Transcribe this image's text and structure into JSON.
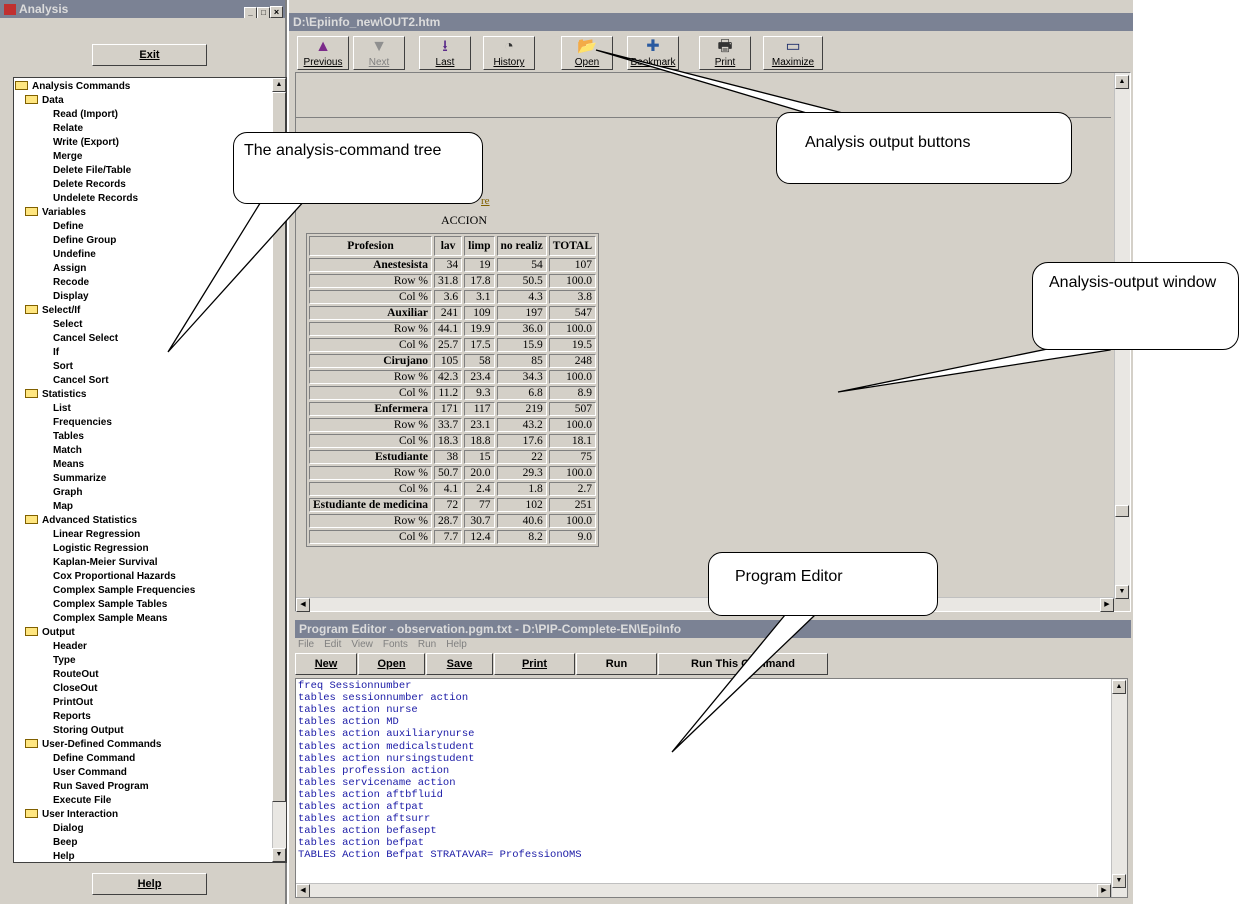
{
  "left": {
    "title": "Analysis",
    "exit": "Exit",
    "help": "Help",
    "tree": [
      {
        "t": "Analysis Commands",
        "f": 1,
        "l": 0
      },
      {
        "t": "Data",
        "f": 1,
        "l": 1
      },
      {
        "t": "Read (Import)",
        "l": 2
      },
      {
        "t": "Relate",
        "l": 2
      },
      {
        "t": "Write (Export)",
        "l": 2
      },
      {
        "t": "Merge",
        "l": 2
      },
      {
        "t": "Delete File/Table",
        "l": 2
      },
      {
        "t": "Delete Records",
        "l": 2
      },
      {
        "t": "Undelete Records",
        "l": 2
      },
      {
        "t": "Variables",
        "f": 1,
        "l": 1
      },
      {
        "t": "Define",
        "l": 2
      },
      {
        "t": "Define Group",
        "l": 2
      },
      {
        "t": "Undefine",
        "l": 2
      },
      {
        "t": "Assign",
        "l": 2
      },
      {
        "t": "Recode",
        "l": 2
      },
      {
        "t": "Display",
        "l": 2
      },
      {
        "t": "Select/If",
        "f": 1,
        "l": 1
      },
      {
        "t": "Select",
        "l": 2
      },
      {
        "t": "Cancel Select",
        "l": 2
      },
      {
        "t": "If",
        "l": 2
      },
      {
        "t": "Sort",
        "l": 2
      },
      {
        "t": "Cancel Sort",
        "l": 2
      },
      {
        "t": "Statistics",
        "f": 1,
        "l": 1
      },
      {
        "t": "List",
        "l": 2
      },
      {
        "t": "Frequencies",
        "l": 2
      },
      {
        "t": "Tables",
        "l": 2
      },
      {
        "t": "Match",
        "l": 2
      },
      {
        "t": "Means",
        "l": 2
      },
      {
        "t": "Summarize",
        "l": 2
      },
      {
        "t": "Graph",
        "l": 2
      },
      {
        "t": "Map",
        "l": 2
      },
      {
        "t": "Advanced Statistics",
        "f": 1,
        "l": 1
      },
      {
        "t": "Linear Regression",
        "l": 2
      },
      {
        "t": "Logistic Regression",
        "l": 2
      },
      {
        "t": "Kaplan-Meier Survival",
        "l": 2
      },
      {
        "t": "Cox Proportional Hazards",
        "l": 2
      },
      {
        "t": "Complex Sample Frequencies",
        "l": 2
      },
      {
        "t": "Complex Sample Tables",
        "l": 2
      },
      {
        "t": "Complex Sample Means",
        "l": 2
      },
      {
        "t": "Output",
        "f": 1,
        "l": 1
      },
      {
        "t": "Header",
        "l": 2
      },
      {
        "t": "Type",
        "l": 2
      },
      {
        "t": "RouteOut",
        "l": 2
      },
      {
        "t": "CloseOut",
        "l": 2
      },
      {
        "t": "PrintOut",
        "l": 2
      },
      {
        "t": "Reports",
        "l": 2
      },
      {
        "t": "Storing Output",
        "l": 2
      },
      {
        "t": "User-Defined Commands",
        "f": 1,
        "l": 1
      },
      {
        "t": "Define Command",
        "l": 2
      },
      {
        "t": "User Command",
        "l": 2
      },
      {
        "t": "Run Saved Program",
        "l": 2
      },
      {
        "t": "Execute File",
        "l": 2
      },
      {
        "t": "User Interaction",
        "f": 1,
        "l": 1
      },
      {
        "t": "Dialog",
        "l": 2
      },
      {
        "t": "Beep",
        "l": 2
      },
      {
        "t": "Help",
        "l": 2
      }
    ]
  },
  "output": {
    "title": "D:\\Epiinfo_new\\OUT2.htm",
    "buttons": [
      {
        "label": "Previous",
        "icon": "▲"
      },
      {
        "label": "Next",
        "icon": "▼"
      },
      {
        "label": "Last",
        "icon": "⭳"
      },
      {
        "label": "History",
        "icon": "◔"
      },
      {
        "label": "Open",
        "icon": "📂"
      },
      {
        "label": "Bookmark",
        "icon": "✚"
      },
      {
        "label": "Print",
        "icon": "🖶"
      },
      {
        "label": "Maximize",
        "icon": "▭"
      }
    ],
    "link_fragment": "re",
    "table_title": "ACCION",
    "headers": [
      "Profesion",
      "lav",
      "limp",
      "no realiz",
      "TOTAL"
    ],
    "groups": [
      {
        "name": "Anestesista",
        "counts": [
          "34",
          "19",
          "54",
          "107"
        ],
        "row": [
          "31.8",
          "17.8",
          "50.5",
          "100.0"
        ],
        "col": [
          "3.6",
          "3.1",
          "4.3",
          "3.8"
        ]
      },
      {
        "name": "Auxiliar",
        "counts": [
          "241",
          "109",
          "197",
          "547"
        ],
        "row": [
          "44.1",
          "19.9",
          "36.0",
          "100.0"
        ],
        "col": [
          "25.7",
          "17.5",
          "15.9",
          "19.5"
        ]
      },
      {
        "name": "Cirujano",
        "counts": [
          "105",
          "58",
          "85",
          "248"
        ],
        "row": [
          "42.3",
          "23.4",
          "34.3",
          "100.0"
        ],
        "col": [
          "11.2",
          "9.3",
          "6.8",
          "8.9"
        ]
      },
      {
        "name": "Enfermera",
        "counts": [
          "171",
          "117",
          "219",
          "507"
        ],
        "row": [
          "33.7",
          "23.1",
          "43.2",
          "100.0"
        ],
        "col": [
          "18.3",
          "18.8",
          "17.6",
          "18.1"
        ]
      },
      {
        "name": "Estudiante",
        "counts": [
          "38",
          "15",
          "22",
          "75"
        ],
        "row": [
          "50.7",
          "20.0",
          "29.3",
          "100.0"
        ],
        "col": [
          "4.1",
          "2.4",
          "1.8",
          "2.7"
        ]
      },
      {
        "name": "Estudiante de medicina",
        "counts": [
          "72",
          "77",
          "102",
          "251"
        ],
        "row": [
          "28.7",
          "30.7",
          "40.6",
          "100.0"
        ],
        "col": [
          "7.7",
          "12.4",
          "8.2",
          "9.0"
        ]
      }
    ],
    "row_label": "Row %",
    "col_label": "Col %"
  },
  "editor": {
    "title": "Program Editor - observation.pgm.txt - D:\\PIP-Complete-EN\\EpiInfo",
    "menu": [
      "File",
      "Edit",
      "View",
      "Fonts",
      "Run",
      "Help"
    ],
    "buttons": [
      "New",
      "Open",
      "Save",
      "Print",
      "Run",
      "Run This Command"
    ],
    "lines": [
      "freq Sessionnumber",
      "tables sessionnumber action",
      "tables action nurse",
      "tables action MD",
      "tables action auxiliarynurse",
      "tables action medicalstudent",
      "tables action nursingstudent",
      "tables profession action",
      "tables servicename action",
      "tables action aftbfluid",
      "tables action aftpat",
      "tables action aftsurr",
      "tables action befasept",
      "tables action befpat",
      "TABLES Action Befpat STRATAVAR= ProfessionOMS"
    ]
  },
  "callouts": {
    "tree": "The analysis-command tree",
    "buttons": "Analysis output buttons",
    "window": "Analysis-output window",
    "editor": "Program Editor"
  }
}
